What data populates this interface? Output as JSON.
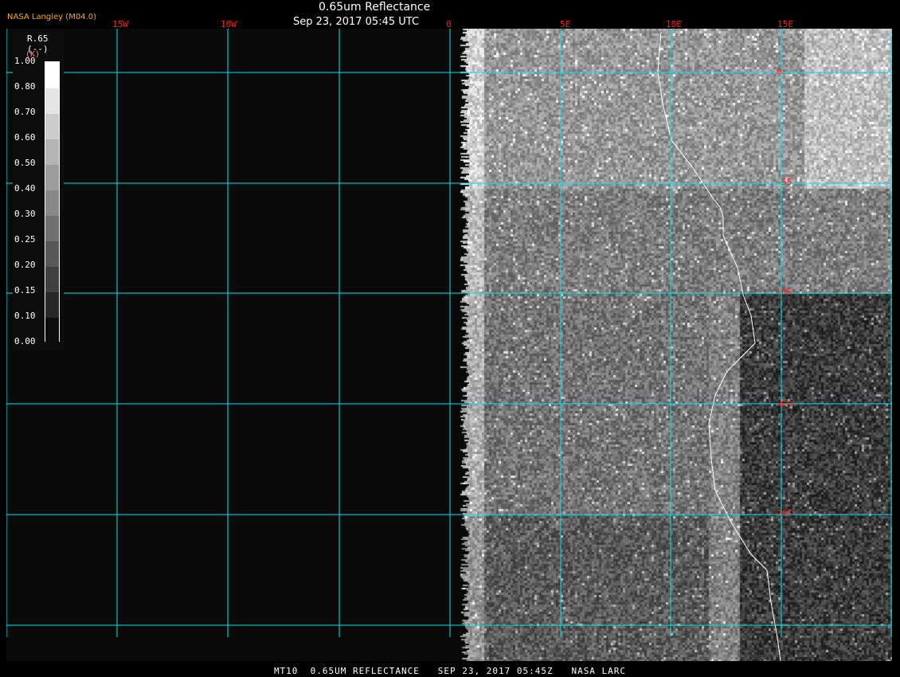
{
  "header": {
    "title": "0.65um Reflectance",
    "datetime": "Sep 23, 2017 05:45 UTC",
    "source": "NASA Langley (M04.0)"
  },
  "lon_labels": [
    "15W",
    "10W",
    "0",
    "5E",
    "10E",
    "15E"
  ],
  "lat_labels": [
    "0",
    "5S",
    "10S",
    "15S",
    "20S"
  ],
  "legend": {
    "var": "R.65",
    "units": "(--)",
    "units_k": "(K)",
    "ticks": [
      "1.00",
      "0.80",
      "0.70",
      "0.60",
      "0.50",
      "0.40",
      "0.30",
      "0.25",
      "0.20",
      "0.15",
      "0.10",
      "0.00"
    ],
    "colors": [
      "#ffffff",
      "#e4e4e4",
      "#cccccc",
      "#b4b4b4",
      "#9c9c9c",
      "#888888",
      "#707070",
      "#585858",
      "#404040",
      "#282828",
      "#0c0c0c"
    ]
  },
  "colors": {
    "grid": "#00e5ee",
    "labels": "#ff2020",
    "coast": "#ffffff",
    "source": "#ffa500"
  },
  "footer": "MT10  0.65UM REFLECTANCE   SEP 23, 2017 05:45Z   NASA LARC"
}
